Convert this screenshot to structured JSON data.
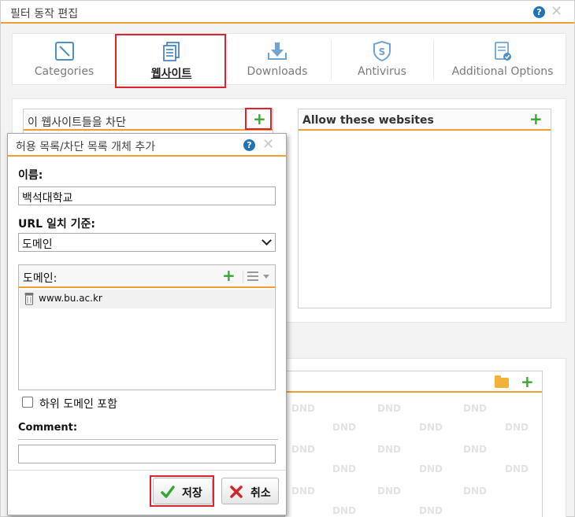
{
  "window": {
    "title": "필터 동작 편집",
    "help": "?"
  },
  "tabs": [
    {
      "label": "Categories",
      "icon": "categories-icon"
    },
    {
      "label": "웹사이트",
      "icon": "website-icon",
      "active": true
    },
    {
      "label": "Downloads",
      "icon": "downloads-icon"
    },
    {
      "label": "Antivirus",
      "icon": "antivirus-icon"
    },
    {
      "label": "Additional Options",
      "icon": "additional-options-icon"
    }
  ],
  "block_panel": {
    "title": "이 웹사이트들을 차단"
  },
  "allow_panel": {
    "title": "Allow these websites"
  },
  "dnd_watermark": "DND",
  "dialog": {
    "title": "허용 목록/차단 목록 개체 추가",
    "help": "?",
    "name_label": "이름:",
    "name_value": "백석대학교",
    "url_match_label": "URL 일치 기준:",
    "url_match_value": "도메인",
    "domain_label": "도메인:",
    "domains": [
      "www.bu.ac.kr"
    ],
    "subdomain_label": "하위 도메인 포함",
    "comment_label": "Comment:",
    "comment_value": "",
    "save_label": "저장",
    "cancel_label": "취소"
  },
  "colors": {
    "accent": "#f0a030",
    "highlight": "#e0212e",
    "plus": "#3aa535",
    "help": "#1f73b7"
  }
}
